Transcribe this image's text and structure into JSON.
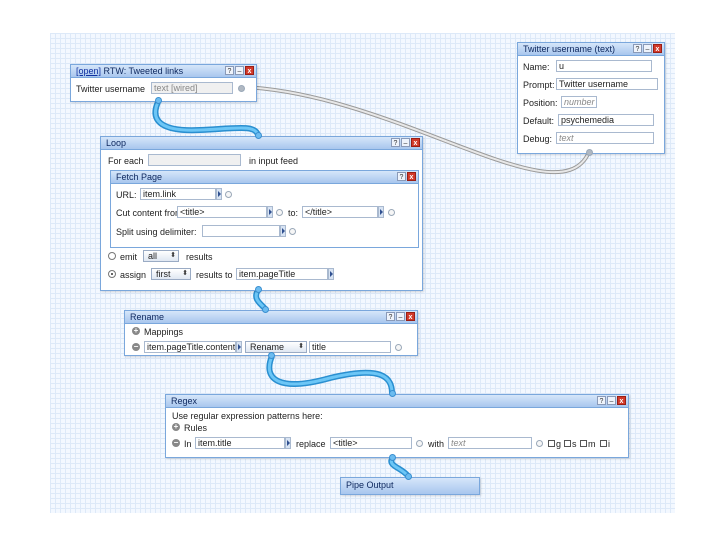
{
  "colors": {
    "wire": "#4fb6ee",
    "canvas": "#f3f8ff",
    "header": "#a8c6ee"
  },
  "twitter_input": {
    "title": "Twitter username (text)",
    "name_label": "Name:",
    "name_value": "u",
    "prompt_label": "Prompt:",
    "prompt_value": "Twitter username",
    "position_label": "Position:",
    "position_placeholder": "number",
    "default_label": "Default:",
    "default_value": "psychemedia",
    "debug_label": "Debug:",
    "debug_placeholder": "text"
  },
  "rtw": {
    "open_link": "[open]",
    "title": "RTW: Tweeted links",
    "field_label": "Twitter username",
    "field_placeholder": "text [wired]"
  },
  "loop": {
    "title": "Loop",
    "for_each": "For each",
    "in_input_feed": "in input feed",
    "fetch": {
      "title": "Fetch Page",
      "url_label": "URL:",
      "url_value": "item.link",
      "cut_label": "Cut content from:",
      "cut_from_value": "<title>",
      "to_label": "to:",
      "cut_to_value": "</title>",
      "split_label": "Split using delimiter:"
    },
    "emit_label": "emit",
    "emit_option": "all",
    "results_label": "results",
    "assign_label": "assign",
    "assign_option": "first",
    "results_to_label": "results to",
    "assign_target": "item.pageTitle"
  },
  "rename": {
    "title": "Rename",
    "mappings_label": "Mappings",
    "source_value": "item.pageTitle.content",
    "op_option": "Rename",
    "target_value": "title"
  },
  "regex": {
    "title": "Regex",
    "hint": "Use regular expression patterns here:",
    "rules_label": "Rules",
    "in_label": "In",
    "in_value": "item.title",
    "replace_label": "replace",
    "replace_value": "<title>",
    "with_label": "with",
    "with_placeholder": "text",
    "flag_g": "g",
    "flag_s": "s",
    "flag_m": "m",
    "flag_i": "i"
  },
  "output": {
    "title": "Pipe Output"
  },
  "window_controls": {
    "help": "?",
    "minimize": "–",
    "close": "x"
  }
}
